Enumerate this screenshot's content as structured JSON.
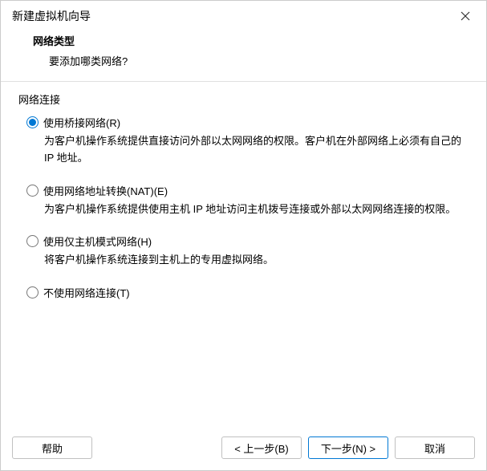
{
  "titlebar": {
    "title": "新建虚拟机向导"
  },
  "header": {
    "title": "网络类型",
    "subtitle": "要添加哪类网络?"
  },
  "group": {
    "label": "网络连接"
  },
  "options": {
    "bridged": {
      "label": "使用桥接网络(R)",
      "desc": "为客户机操作系统提供直接访问外部以太网网络的权限。客户机在外部网络上必须有自己的 IP 地址。"
    },
    "nat": {
      "label": "使用网络地址转换(NAT)(E)",
      "desc": "为客户机操作系统提供使用主机 IP 地址访问主机拨号连接或外部以太网网络连接的权限。"
    },
    "hostonly": {
      "label": "使用仅主机模式网络(H)",
      "desc": "将客户机操作系统连接到主机上的专用虚拟网络。"
    },
    "none": {
      "label": "不使用网络连接(T)"
    }
  },
  "footer": {
    "help": "帮助",
    "back": "< 上一步(B)",
    "next": "下一步(N) >",
    "cancel": "取消"
  }
}
